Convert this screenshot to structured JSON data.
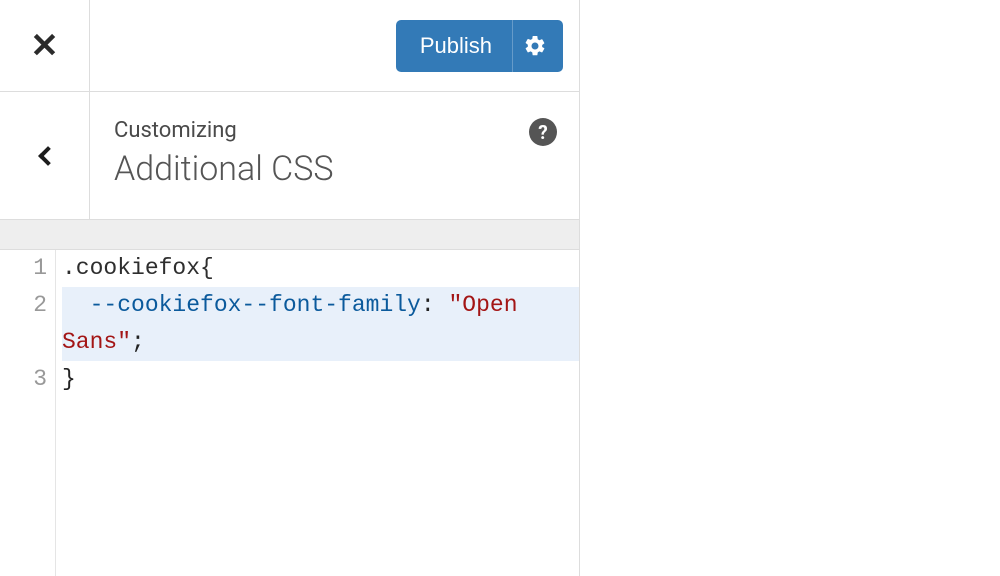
{
  "header": {
    "publish_label": "Publish"
  },
  "section": {
    "eyebrow": "Customizing",
    "title": "Additional CSS",
    "help_label": "?"
  },
  "editor": {
    "lines": [
      "1",
      "2",
      "3"
    ],
    "code": {
      "line1": ".cookiefox{",
      "line2_indent": "  ",
      "line2_prop": "--cookiefox--font-family",
      "line2_colon": ": ",
      "line2_value": "\"Open Sans\"",
      "line2_semi": ";",
      "line3": "}"
    }
  }
}
